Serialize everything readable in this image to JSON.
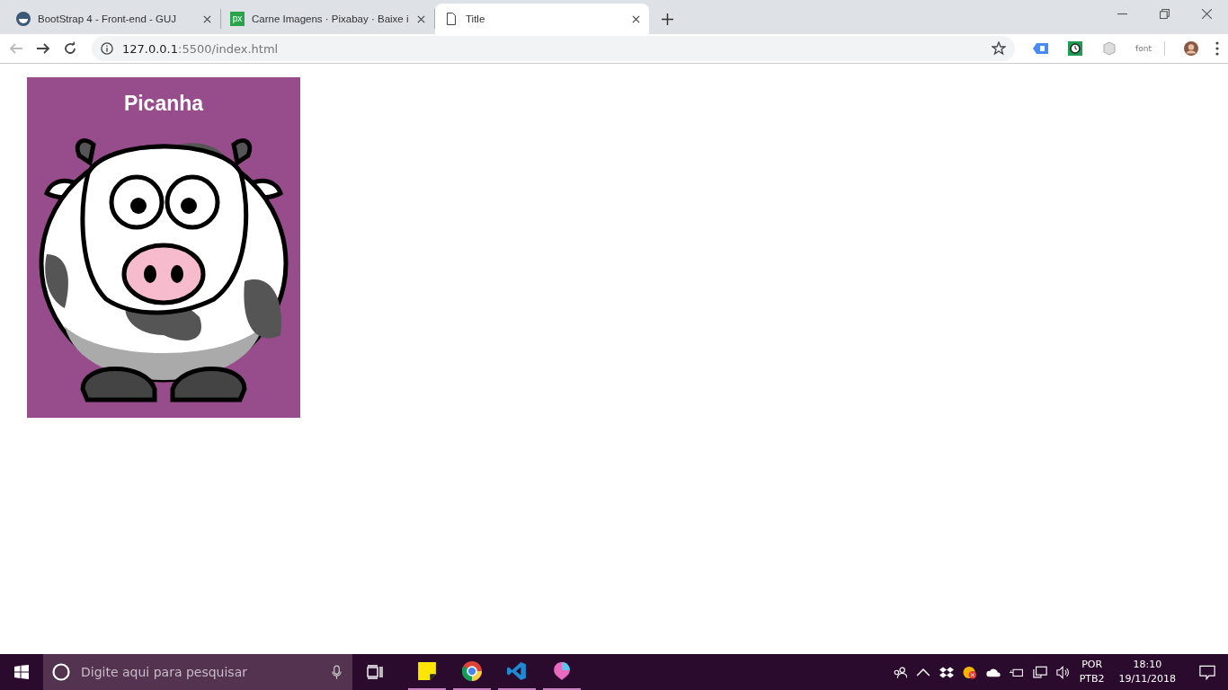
{
  "browser": {
    "tabs": [
      {
        "title": "BootStrap 4 - Front-end - GUJ",
        "kind": "guj",
        "selected": false
      },
      {
        "title": "Carne Imagens · Pixabay · Baixe i",
        "kind": "px",
        "icon_text": "px",
        "selected": false
      },
      {
        "title": "Title",
        "kind": "page",
        "selected": true
      }
    ],
    "address": {
      "host": "127.0.0.1",
      "rest": ":5500/index.html"
    },
    "extension_label": "font"
  },
  "page": {
    "card": {
      "title": "Picanha"
    }
  },
  "taskbar": {
    "search": {
      "placeholder": "Digite aqui para pesquisar"
    },
    "apps": [
      {
        "kind": "notes",
        "running": true
      },
      {
        "kind": "chrome",
        "running": true
      },
      {
        "kind": "vscode",
        "running": true
      },
      {
        "kind": "paint",
        "running": true
      }
    ],
    "language": [
      "POR",
      "PTB2"
    ],
    "time": "18:10",
    "date": "19/11/2018"
  }
}
